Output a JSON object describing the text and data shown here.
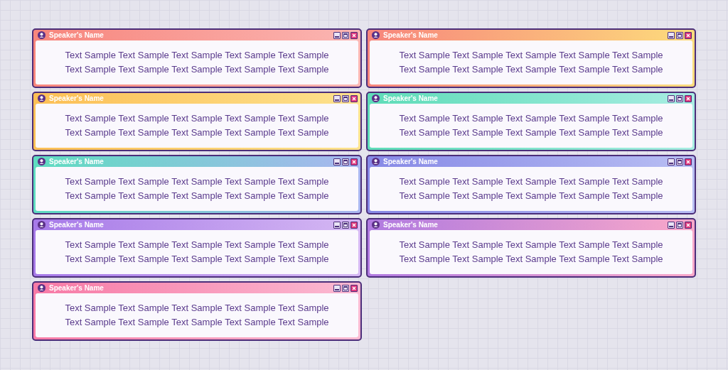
{
  "dialogs": [
    {
      "title": "Speaker's Name",
      "gradient": [
        {
          "color": "#f7857c"
        },
        {
          "color": "#fbb6b3"
        }
      ],
      "lines": [
        "Text Sample Text Sample Text Sample Text Sample Text Sample",
        "Text Sample Text Sample Text Sample Text Sample Text Sample"
      ]
    },
    {
      "title": "Speaker's Name",
      "gradient": [
        {
          "color": "#f7857c"
        },
        {
          "color": "#fddc7c"
        }
      ],
      "lines": [
        "Text Sample Text Sample Text Sample Text Sample Text Sample",
        "Text Sample Text Sample Text Sample Text Sample Text Sample"
      ]
    },
    {
      "title": "Speaker's Name",
      "gradient": [
        {
          "color": "#fcbf55"
        },
        {
          "color": "#fde28e"
        }
      ],
      "lines": [
        "Text Sample Text Sample Text Sample Text Sample Text Sample",
        "Text Sample Text Sample Text Sample Text Sample Text Sample"
      ]
    },
    {
      "title": "Speaker's Name",
      "gradient": [
        {
          "color": "#5edcb8"
        },
        {
          "color": "#a8ede2"
        }
      ],
      "lines": [
        "Text Sample Text Sample Text Sample Text Sample Text Sample",
        "Text Sample Text Sample Text Sample Text Sample Text Sample"
      ]
    },
    {
      "title": "Speaker's Name",
      "gradient": [
        {
          "color": "#5edcc0"
        },
        {
          "color": "#a9b6f0"
        }
      ],
      "lines": [
        "Text Sample Text Sample Text Sample Text Sample Text Sample",
        "Text Sample Text Sample Text Sample Text Sample Text Sample"
      ]
    },
    {
      "title": "Speaker's Name",
      "gradient": [
        {
          "color": "#8789e6"
        },
        {
          "color": "#b8bef3"
        }
      ],
      "lines": [
        "Text Sample Text Sample Text Sample Text Sample Text Sample",
        "Text Sample Text Sample Text Sample Text Sample Text Sample"
      ]
    },
    {
      "title": "Speaker's Name",
      "gradient": [
        {
          "color": "#a679e8"
        },
        {
          "color": "#d5b8f3"
        }
      ],
      "lines": [
        "Text Sample Text Sample Text Sample Text Sample Text Sample",
        "Text Sample Text Sample Text Sample Text Sample Text Sample"
      ]
    },
    {
      "title": "Speaker's Name",
      "gradient": [
        {
          "color": "#b07ae0"
        },
        {
          "color": "#f9a8c9"
        }
      ],
      "lines": [
        "Text Sample Text Sample Text Sample Text Sample Text Sample",
        "Text Sample Text Sample Text Sample Text Sample Text Sample"
      ]
    },
    {
      "title": "Speaker's Name",
      "gradient": [
        {
          "color": "#f77aa6"
        },
        {
          "color": "#fbbad2"
        }
      ],
      "lines": [
        "Text Sample Text Sample Text Sample Text Sample Text Sample",
        "Text Sample Text Sample Text Sample Text Sample Text Sample"
      ]
    }
  ]
}
